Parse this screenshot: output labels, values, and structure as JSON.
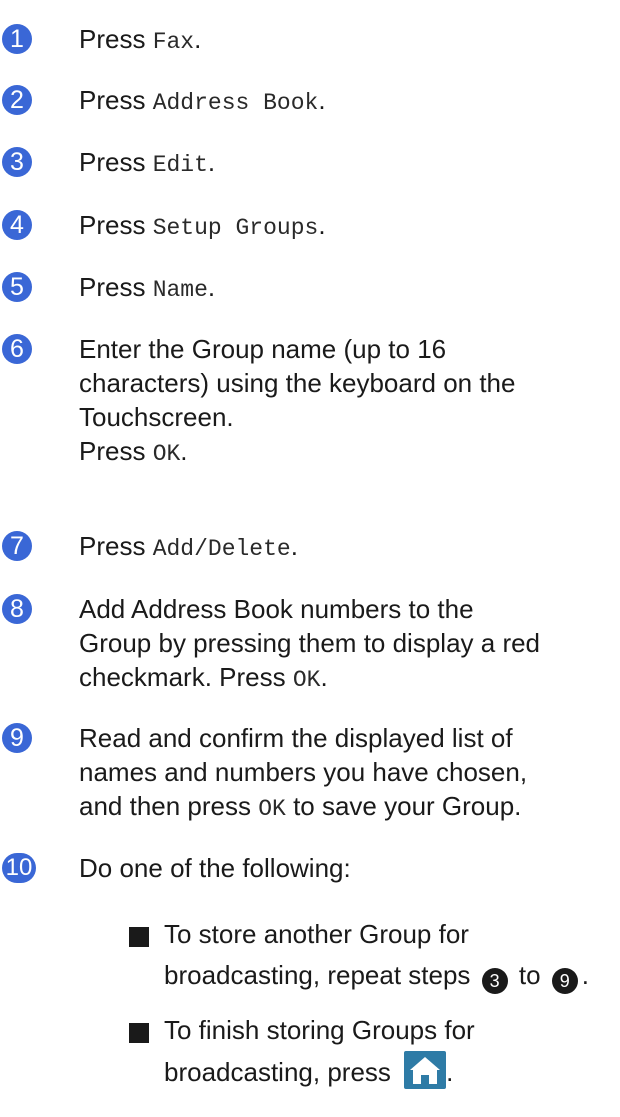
{
  "steps": [
    {
      "num": "1",
      "parts": [
        "Press ",
        "Fax",
        "."
      ]
    },
    {
      "num": "2",
      "parts": [
        "Press ",
        "Address Book",
        "."
      ]
    },
    {
      "num": "3",
      "parts": [
        "Press ",
        "Edit",
        "."
      ]
    },
    {
      "num": "4",
      "parts": [
        "Press ",
        "Setup Groups",
        "."
      ]
    },
    {
      "num": "5",
      "parts": [
        "Press ",
        "Name",
        "."
      ]
    },
    {
      "num": "6",
      "lines": [
        "Enter the Group name (up to 16",
        "characters)  using the keyboard on the",
        "Touchscreen."
      ],
      "press": [
        "Press ",
        "OK",
        "."
      ]
    },
    {
      "num": "7",
      "parts": [
        "Press ",
        "Add/Delete",
        "."
      ]
    },
    {
      "num": "8",
      "lines": [
        "Add Address Book numbers to the",
        "Group by pressing them to display a red"
      ],
      "last": [
        "checkmark. Press ",
        "OK",
        "."
      ]
    },
    {
      "num": "9",
      "lines": [
        "Read and confirm the displayed list of",
        "names and numbers you have chosen,"
      ],
      "last": [
        "and then press ",
        "OK",
        " to save your Group."
      ]
    },
    {
      "num": "10",
      "text": "Do one of the following:"
    }
  ],
  "bullets": [
    {
      "line1": "To store another Group for",
      "line2_pre": "broadcasting, repeat steps ",
      "ref_a": "3",
      "mid": " to ",
      "ref_b": "9",
      "end": "."
    },
    {
      "line1": "To finish storing Groups for",
      "line2_pre": "broadcasting, press ",
      "icon": "home-icon",
      "end": "."
    }
  ]
}
